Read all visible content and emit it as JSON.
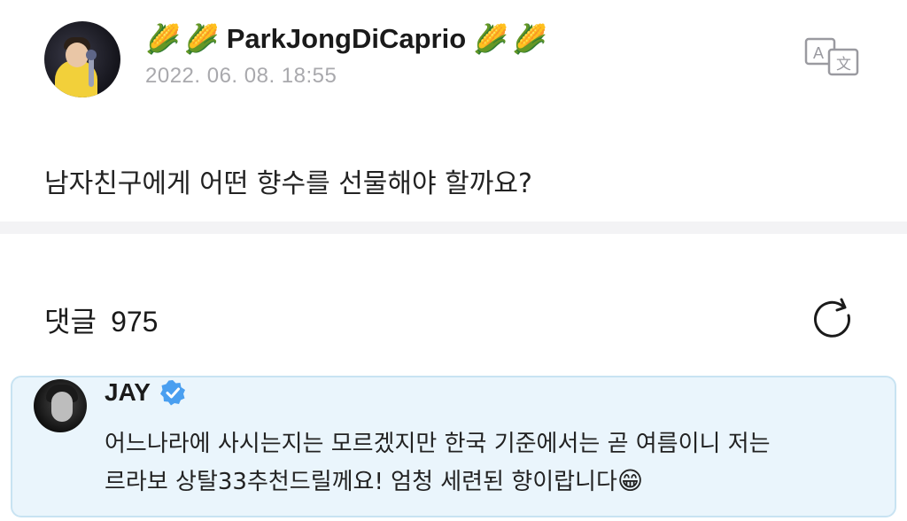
{
  "post": {
    "author": "ParkJongDiCaprio",
    "author_decoration": "🌽",
    "timestamp": "2022. 06. 08. 18:55",
    "translate_icon": "translate-icon",
    "body": "남자친구에게 어떤 향수를 선물해야 할까요?"
  },
  "comments": {
    "label": "댓글",
    "count": "975",
    "refresh_icon": "refresh-icon",
    "items": [
      {
        "author": "JAY",
        "verified_icon": "verified-badge-icon",
        "text_line1": "어느나라에 사시는지는 모르겠지만 한국 기준에서는 곧 여름이니 저는",
        "text_line2": "르라보 상탈33추천드릴께요! 엄청 세련된 향이랍니다",
        "emoji": "😁"
      }
    ]
  },
  "colors": {
    "timestamp": "#a9a9ad",
    "divider": "#f3f3f5",
    "comment_bg": "#eaf5fc",
    "comment_border": "#c8e3f2",
    "verified": "#4a9ff0"
  }
}
